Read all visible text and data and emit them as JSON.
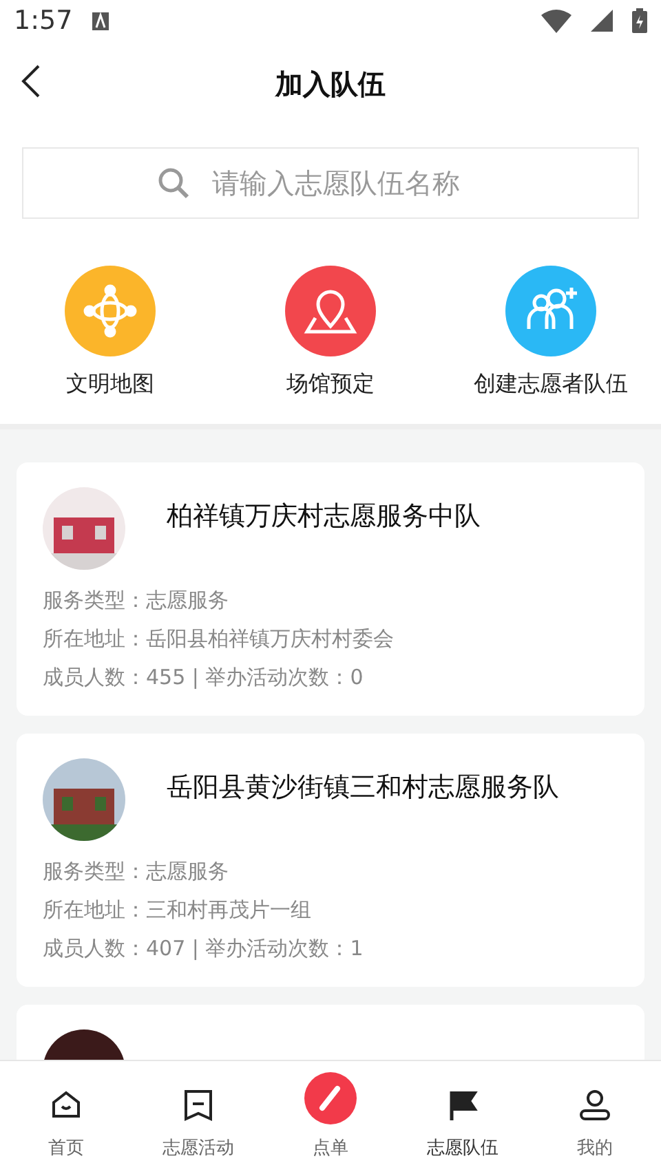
{
  "status_bar": {
    "time": "1:57"
  },
  "header": {
    "title": "加入队伍"
  },
  "search": {
    "placeholder": "请输入志愿队伍名称"
  },
  "shortcuts": [
    {
      "label": "文明地图",
      "color": "#fbb52a"
    },
    {
      "label": "场馆预定",
      "color": "#f2474d"
    },
    {
      "label": "创建志愿者队伍",
      "color": "#2ab8f5"
    }
  ],
  "teams": [
    {
      "name": "柏祥镇万庆村志愿服务中队",
      "service_type": "服务类型：志愿服务",
      "address": "所在地址：岳阳县柏祥镇万庆村村委会",
      "stats": "成员人数：455 | 举办活动次数：0",
      "avatar": {
        "kind": "picture"
      }
    },
    {
      "name": "岳阳县黄沙街镇三和村志愿服务队",
      "service_type": "服务类型：志愿服务",
      "address": "所在地址：三和村再茂片一组",
      "stats": "成员人数：407 | 举办活动次数：1",
      "avatar": {
        "kind": "picture"
      }
    },
    {
      "avatar": {
        "kind": "picture"
      }
    }
  ],
  "tab_bar": [
    {
      "label": "首页",
      "kind": "plain",
      "selected": false
    },
    {
      "label": "志愿活动",
      "kind": "plain",
      "selected": false
    },
    {
      "label": "点单",
      "kind": "center",
      "selected": false
    },
    {
      "label": "志愿队伍",
      "kind": "plain",
      "selected": true
    },
    {
      "label": "我的",
      "kind": "plain",
      "selected": false
    }
  ]
}
